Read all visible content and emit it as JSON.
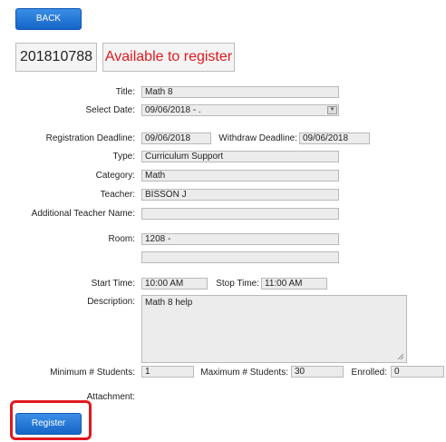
{
  "back_button": "BACK",
  "course_id": "201810788",
  "status": "Available to register",
  "fields": {
    "title": {
      "label": "Title:",
      "value": "Math 8"
    },
    "select_date": {
      "label": "Select Date:",
      "value": "09/06/2018 - ."
    },
    "registration_deadline": {
      "label": "Registration Deadline:",
      "value": "09/06/2018"
    },
    "withdraw_deadline": {
      "label": "Withdraw Deadline:",
      "value": "09/06/2018"
    },
    "type": {
      "label": "Type:",
      "value": "Curriculum Support"
    },
    "category": {
      "label": "Category:",
      "value": "Math"
    },
    "teacher": {
      "label": "Teacher:",
      "value": "BISSON J"
    },
    "additional_teacher": {
      "label": "Additional Teacher Name:",
      "value": ""
    },
    "room": {
      "label": "Room:",
      "value": "1208 -",
      "value2": ""
    },
    "start_time": {
      "label": "Start Time:",
      "value": "10:00 AM"
    },
    "stop_time": {
      "label": "Stop Time:",
      "value": "11:00 AM"
    },
    "description": {
      "label": "Description:",
      "value": "Math 8 help"
    },
    "min_students": {
      "label": "Minimum # Students:",
      "value": "1"
    },
    "max_students": {
      "label": "Maximum # Students:",
      "value": "30"
    },
    "enrolled": {
      "label": "Enrolled:",
      "value": "0"
    },
    "attachment": {
      "label": "Attachment:"
    }
  },
  "register_button": "Register",
  "colors": {
    "accent": "#1565c8",
    "status": "#e0191e",
    "highlight": "#e0191e"
  }
}
